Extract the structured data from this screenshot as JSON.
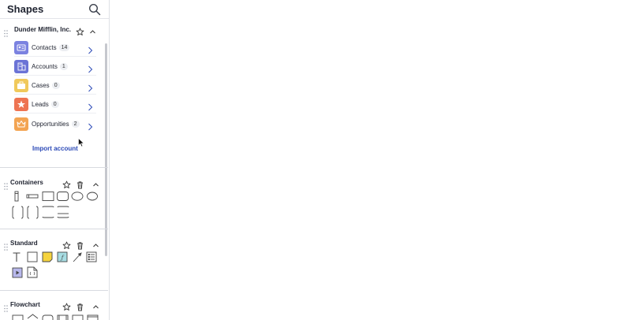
{
  "panel": {
    "title": "Shapes"
  },
  "account": {
    "name": "Dunder Mifflin, Inc.",
    "items": [
      {
        "label": "Contacts",
        "count": "14",
        "color": "#7b82e0",
        "icon": "contact-card-icon"
      },
      {
        "label": "Accounts",
        "count": "1",
        "color": "#6b73d6",
        "icon": "building-icon"
      },
      {
        "label": "Cases",
        "count": "0",
        "color": "#f0c95b",
        "icon": "briefcase-icon"
      },
      {
        "label": "Leads",
        "count": "0",
        "color": "#ee7452",
        "icon": "star-icon"
      },
      {
        "label": "Opportunities",
        "count": "2",
        "color": "#f3a452",
        "icon": "crown-icon"
      }
    ],
    "import_label": "Import account"
  },
  "sections": {
    "containers": {
      "title": "Containers"
    },
    "standard": {
      "title": "Standard"
    },
    "flowchart": {
      "title": "Flowchart"
    }
  },
  "colors": {
    "accent": "#2b49b7",
    "sticky_note": "#f5d33e",
    "formula": "#a7dde3",
    "video": "#b8b8ec"
  }
}
